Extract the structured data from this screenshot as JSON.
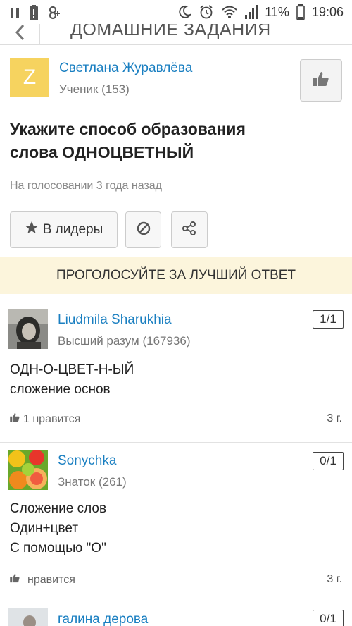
{
  "status_bar": {
    "battery": "11%",
    "time": "19:06",
    "icons": [
      "pause-icon",
      "battery-alert-icon",
      "app-icon",
      "moon-icon",
      "alarm-icon",
      "wifi-icon",
      "signal-icon"
    ]
  },
  "header": {
    "title": "ДОМАШНИЕ ЗАДАНИЯ",
    "back_icon": "chevron-left-icon"
  },
  "author": {
    "initial": "Z",
    "name": "Светлана Журавлёва",
    "rank": "Ученик (153)",
    "avatar_color": "#f6d35f"
  },
  "question": {
    "line1": "Укажите способ образования",
    "line2": "слова ОДНОЦВЕТНЫЙ",
    "status": "На голосовании 3 года назад"
  },
  "actions": {
    "leaders_label": "В лидеры"
  },
  "banner": {
    "text": "ПРОГОЛОСУЙТЕ ЗА ЛУЧШИЙ ОТВЕТ",
    "color": "#fcf5dc"
  },
  "answers": [
    {
      "name": "Liudmila Sharukhia",
      "rank": "Высший разум (167936)",
      "score": "1/1",
      "text": [
        "ОДН-О-ЦВЕТ-Н-ЫЙ",
        "сложение основ"
      ],
      "likes": "1 нравится",
      "time": "3 г."
    },
    {
      "name": "Sonychka",
      "rank": "Знаток (261)",
      "score": "0/1",
      "text": [
        "Сложение слов",
        "Один+цвет",
        "С помощью \"О\""
      ],
      "likes": "нравится",
      "time": "3 г."
    },
    {
      "name": "галина дерова",
      "score": "0/1"
    }
  ],
  "colors": {
    "link": "#1a7fc1",
    "muted": "#777777"
  }
}
